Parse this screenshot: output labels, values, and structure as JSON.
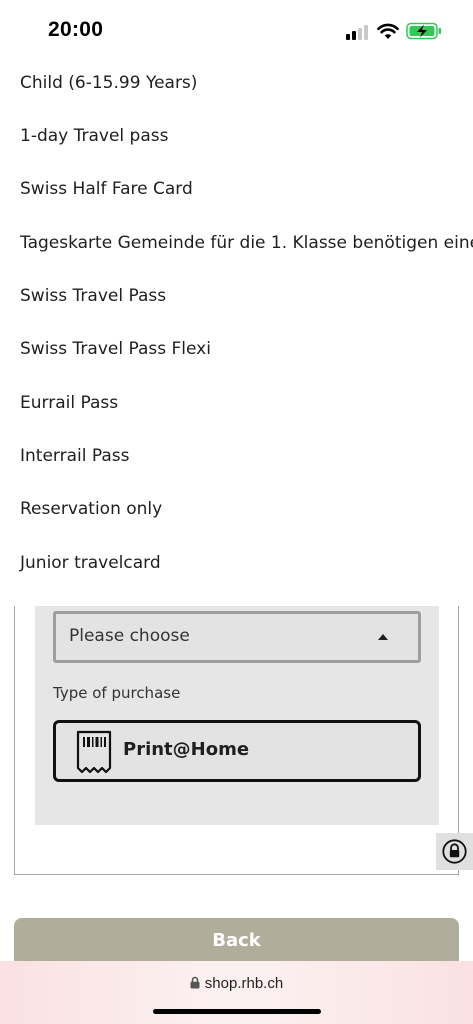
{
  "status_bar": {
    "time": "20:00",
    "icons": [
      "cellular-signal-icon",
      "wifi-icon",
      "battery-charging-icon"
    ],
    "battery_color": "#34c759"
  },
  "options": [
    "Child (6-15.99 Years)",
    "1-day Travel pass",
    "Swiss Half Fare Card",
    "Tageskarte Gemeinde für die 1. Klasse benötigen eine",
    "Swiss Travel Pass",
    "Swiss Travel Pass Flexi",
    "Eurrail Pass",
    "Interrail Pass",
    "Reservation only",
    "Junior travelcard"
  ],
  "form": {
    "select_value": "Please choose",
    "purchase_label": "Type of purchase",
    "purchase_option": "Print@Home",
    "purchase_icon": "ticket-receipt-icon"
  },
  "lock_icon": "lock-icon",
  "back_button": {
    "label": "Back",
    "color": "#b1ad9b"
  },
  "browser": {
    "url": "shop.rhb.ch",
    "url_icon": "lock-icon"
  }
}
